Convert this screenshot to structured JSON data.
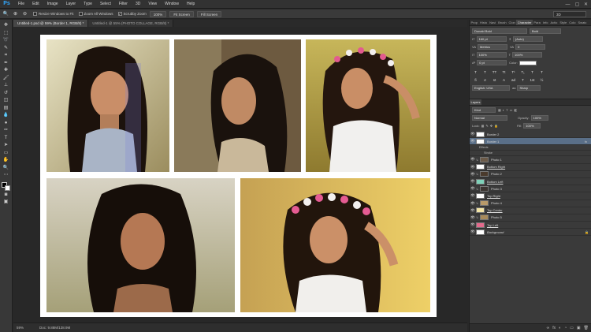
{
  "app": {
    "logo": "Ps"
  },
  "menu": [
    "File",
    "Edit",
    "Image",
    "Layer",
    "Type",
    "Select",
    "Filter",
    "3D",
    "View",
    "Window",
    "Help"
  ],
  "window_controls": [
    "—",
    "▢",
    "✕"
  ],
  "options": {
    "scroll_all": "Resize Windows to Fit",
    "zoom_all": "Zoom All Windows",
    "scrubby": "Scrubby Zoom",
    "btn_100": "100%",
    "btn_fit": "Fit Screen",
    "btn_fill": "Fill Screen",
    "workspace": "3D"
  },
  "doc_tabs": [
    {
      "label": "Untitled-1.psd @ 59% (Border 1, RGB/8) *",
      "active": true
    },
    {
      "label": "Untitled-1 @ 55% (PHOTO COLLAGE, RGB/8) *",
      "active": false
    }
  ],
  "status": {
    "zoom": "59%",
    "doc": "Doc: 9.88M/138.9M"
  },
  "char_panel": {
    "tabs": [
      "Prop",
      "Histo",
      "Navi",
      "Brush",
      "Clon",
      "Character",
      "Para",
      "Info",
      "Actio",
      "Style",
      "Colo",
      "Swatc"
    ],
    "font_family": "Donald Bold",
    "font_style": "Bold",
    "size": "160 pt",
    "leading": "(Auto)",
    "kerning": "Metrics",
    "tracking": "0",
    "vscale": "100%",
    "hscale": "100%",
    "baseline": "0 pt",
    "color_label": "Color:",
    "language": "English: USA",
    "aa": "Sharp",
    "style_buttons": [
      "T",
      "T",
      "TT",
      "Tt",
      "T¹",
      "T₁",
      "T",
      "T"
    ],
    "opentype_buttons": [
      "fi",
      "σ",
      "st",
      "A",
      "ad",
      "T",
      "1st",
      "½"
    ]
  },
  "layers": {
    "tabs": [
      "Layers"
    ],
    "kind": "Kind",
    "blend": "Normal",
    "opacity_label": "Opacity:",
    "opacity": "100%",
    "lock_label": "Lock:",
    "fill_label": "Fill:",
    "fill": "100%",
    "rows": [
      {
        "name": "Border 2",
        "type": "layer",
        "sel": false
      },
      {
        "name": "Border 1",
        "type": "layer",
        "sel": true,
        "fx": "fx"
      },
      {
        "name": "Effects",
        "type": "sub"
      },
      {
        "name": "Stroke",
        "type": "sub"
      },
      {
        "name": "Photo 1",
        "type": "clip"
      },
      {
        "name": "Bottom Right",
        "type": "layer"
      },
      {
        "name": "Photo 2",
        "type": "clip"
      },
      {
        "name": "Bottom Left",
        "type": "layer"
      },
      {
        "name": "Photo 3",
        "type": "clip"
      },
      {
        "name": "Top Right",
        "type": "layer"
      },
      {
        "name": "Photo 4",
        "type": "clip"
      },
      {
        "name": "Top Center",
        "type": "layer"
      },
      {
        "name": "Photo 5",
        "type": "clip"
      },
      {
        "name": "Top Left",
        "type": "layer"
      },
      {
        "name": "Background",
        "type": "bg"
      }
    ],
    "foot": [
      "∞",
      "fx",
      "◐",
      "◔",
      "▭",
      "▣",
      "🗑"
    ]
  }
}
